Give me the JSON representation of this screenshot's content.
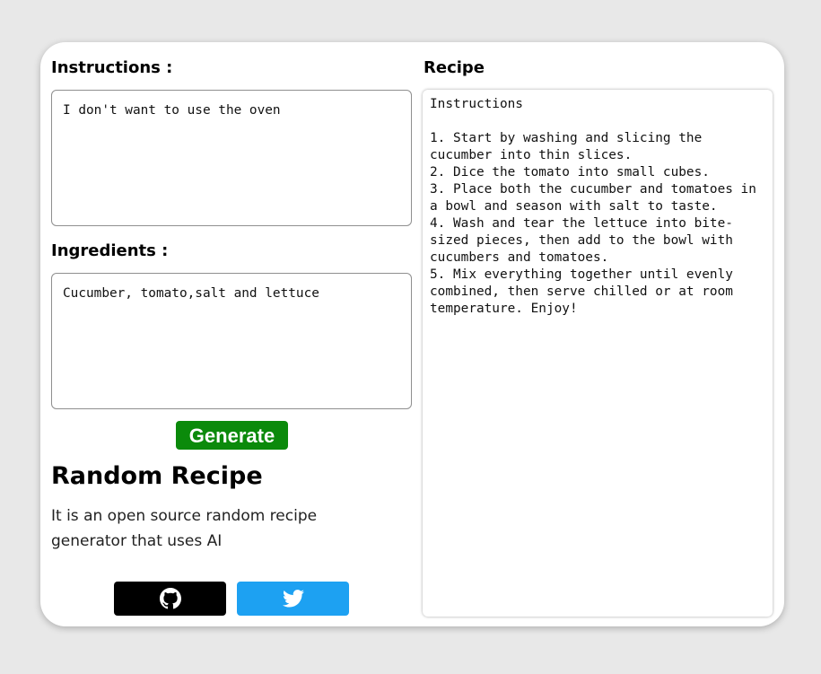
{
  "left_panel": {
    "instructions_label": "Instructions :",
    "instructions_value": "I don't want to use the oven",
    "ingredients_label": "Ingredients :",
    "ingredients_value": "Cucumber, tomato,salt and lettuce",
    "generate_label": "Generate",
    "title": "Random Recipe",
    "description": "It is an open source random recipe generator that uses AI",
    "social": [
      {
        "name": "github",
        "icon": "github-icon",
        "color": "#000000"
      },
      {
        "name": "twitter",
        "icon": "twitter-icon",
        "color": "#1da1f2"
      }
    ]
  },
  "right_panel": {
    "recipe_label": "Recipe",
    "recipe_text": "Instructions\n\n1. Start by washing and slicing the cucumber into thin slices.\n2. Dice the tomato into small cubes.\n3. Place both the cucumber and tomatoes in a bowl and season with salt to taste.\n4. Wash and tear the lettuce into bite-sized pieces, then add to the bowl with cucumbers and tomatoes.\n5. Mix everything together until evenly combined, then serve chilled or at room temperature. Enjoy!"
  },
  "colors": {
    "generate_button": "#0b8a0b",
    "background": "#e8e8e8",
    "card": "#ffffff"
  }
}
